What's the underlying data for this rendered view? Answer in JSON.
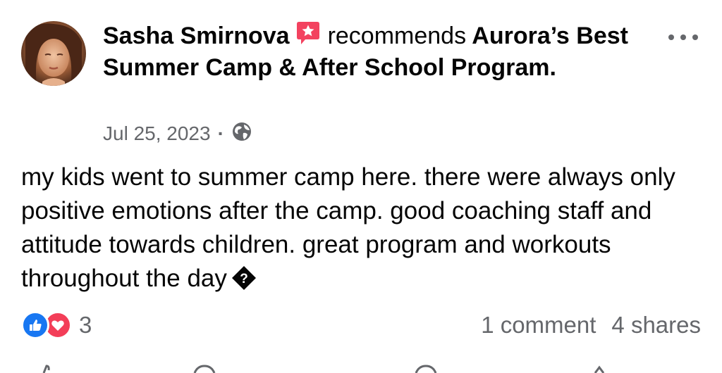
{
  "post": {
    "author": {
      "name": "Sasha Smirnova",
      "avatar_icon": "avatar-photo"
    },
    "action_text": "recommends",
    "page_name": "Aurora’s Best Summer Camp & After School Program.",
    "recommend_icon": "star-speech-bubble-icon",
    "more_icon": "more-options-icon",
    "date": "Jul 25, 2023",
    "separator": "·",
    "privacy_icon": "globe-icon",
    "body": "my kids went to summer camp here. there were always only positive emotions after the camp. good coaching staff and attitude towards children. great program and workouts throughout the day",
    "body_trailing_icon": "unknown-emoji-icon"
  },
  "stats": {
    "reaction_icons": [
      "like-icon",
      "love-icon"
    ],
    "reaction_count": "3",
    "comments": "1 comment",
    "shares": "4 shares"
  },
  "colors": {
    "text_primary": "#050505",
    "text_secondary": "#65676b",
    "like_blue": "#1877f2",
    "love_red": "#f33e58",
    "recommend_pink": "#f3425f",
    "background": "#ffffff"
  }
}
